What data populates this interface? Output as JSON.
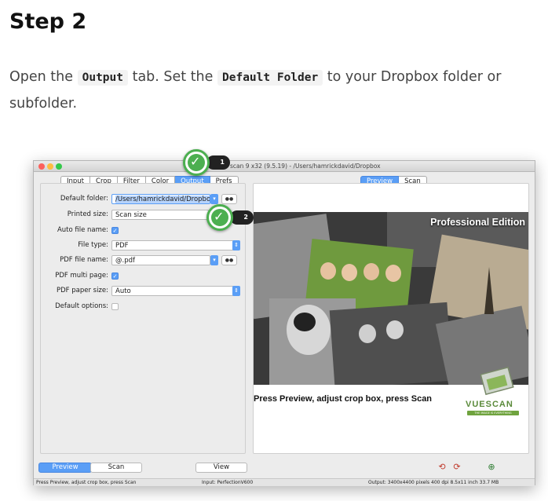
{
  "article": {
    "heading": "Step 2",
    "p_open": "Open the",
    "code_tab": "Output",
    "p_mid": "tab. Set the",
    "code_folder": "Default Folder",
    "p_end": "to your Dropbox folder or subfolder."
  },
  "window": {
    "title": "scan 9 x32 (9.5.19) - /Users/hamrickdavid/Dropbox",
    "tabs": [
      "Input",
      "Crop",
      "Filter",
      "Color",
      "Output",
      "Prefs"
    ],
    "active_tab": "Output",
    "right_tabs": [
      "Preview",
      "Scan"
    ],
    "form": {
      "default_folder_label": "Default folder:",
      "default_folder_value": "/Users/hamrickdavid/Dropbox",
      "printed_size_label": "Printed size:",
      "printed_size_value": "Scan size",
      "auto_file_name_label": "Auto file name:",
      "file_type_label": "File type:",
      "file_type_value": "PDF",
      "pdf_file_name_label": "PDF file name:",
      "pdf_file_name_value": "@.pdf",
      "pdf_multi_page_label": "PDF multi page:",
      "pdf_paper_size_label": "PDF paper size:",
      "pdf_paper_size_value": "Auto",
      "default_options_label": "Default options:"
    },
    "preview": {
      "edition": "Professional Edition",
      "press_message": "Press Preview, adjust crop box, press Scan",
      "logo_text": "VUESCAN",
      "logo_tagline": "THE IMAGE IS EVERYTHING"
    },
    "bottom_buttons": {
      "preview": "Preview",
      "scan": "Scan",
      "view": "View"
    },
    "status": {
      "left": "Press Preview, adjust crop box, press Scan",
      "middle": "Input: PerfectionV600",
      "right": "Output: 3400x4400 pixels 400 dpi 8.5x11 inch 33.7 MB"
    },
    "callouts": [
      "1",
      "2"
    ]
  },
  "colors": {
    "accent": "#5a9ef6",
    "callout_green": "#4caf50"
  }
}
